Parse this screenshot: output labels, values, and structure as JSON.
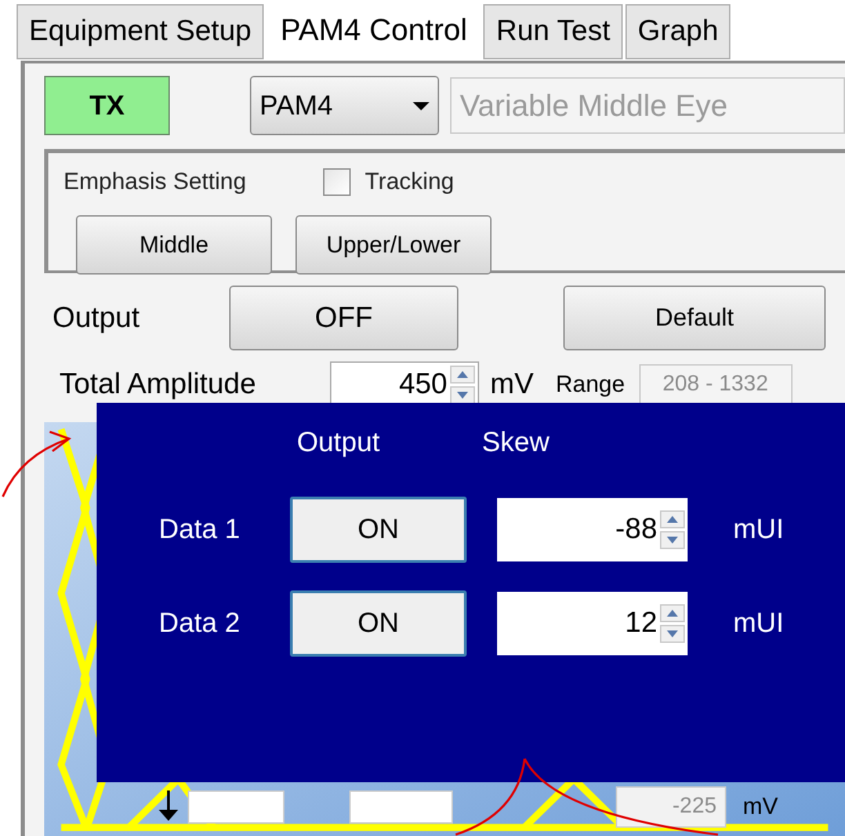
{
  "tabs": [
    {
      "label": "Equipment Setup",
      "selected": false
    },
    {
      "label": "PAM4 Control",
      "selected": true
    },
    {
      "label": "Run Test",
      "selected": false
    },
    {
      "label": "Graph",
      "selected": false
    }
  ],
  "mode_indicator": {
    "label": "TX",
    "on": true
  },
  "signal_dropdown": {
    "value": "PAM4"
  },
  "eye_mode_field": {
    "value": "Variable Middle Eye",
    "disabled": true
  },
  "emphasis": {
    "title": "Emphasis Setting",
    "tracking": {
      "label": "Tracking",
      "checked": false
    },
    "buttons": [
      "Middle",
      "Upper/Lower"
    ]
  },
  "output": {
    "label": "Output",
    "button": "OFF"
  },
  "default_button": "Default",
  "amplitude": {
    "label": "Total Amplitude",
    "value": "450",
    "unit": "mV",
    "range_label": "Range",
    "range": "208 - 1332"
  },
  "eye_panel": {
    "offset_value": "-225",
    "unit": "mV"
  },
  "skew_panel": {
    "headers": [
      "Output",
      "Skew"
    ],
    "rows": [
      {
        "label": "Data 1",
        "output": "ON",
        "skew": "-88",
        "unit": "mUI"
      },
      {
        "label": "Data 2",
        "output": "ON",
        "skew": "12",
        "unit": "mUI"
      }
    ]
  }
}
